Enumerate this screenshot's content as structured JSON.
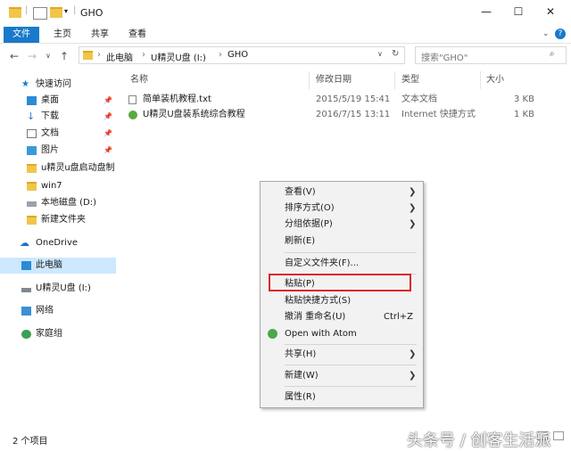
{
  "window": {
    "title": "GHO",
    "minimize": "—",
    "maximize": "☐",
    "close": "✕"
  },
  "ribbon": {
    "tabs": [
      "文件",
      "主页",
      "共享",
      "查看"
    ]
  },
  "addressbar": {
    "segments": [
      "此电脑",
      "U精灵U盘 (I:)",
      "GHO"
    ],
    "search_placeholder": "搜索\"GHO\""
  },
  "sidebar": {
    "items": [
      {
        "label": "快速访问"
      },
      {
        "label": "桌面"
      },
      {
        "label": "下载"
      },
      {
        "label": "文档"
      },
      {
        "label": "图片"
      },
      {
        "label": "u精灵u盘启动盘制"
      },
      {
        "label": "win7"
      },
      {
        "label": "本地磁盘 (D:)"
      },
      {
        "label": "新建文件夹"
      },
      {
        "label": "OneDrive"
      },
      {
        "label": "此电脑"
      },
      {
        "label": "U精灵U盘 (I:)"
      },
      {
        "label": "网络"
      },
      {
        "label": "家庭组"
      }
    ]
  },
  "columns": {
    "name": "名称",
    "modified": "修改日期",
    "type": "类型",
    "size": "大小"
  },
  "files": [
    {
      "name": "简单装机教程.txt",
      "modified": "2015/5/19 15:41",
      "type": "文本文档",
      "size": "3 KB"
    },
    {
      "name": "U精灵U盘装系统综合教程",
      "modified": "2016/7/15 13:11",
      "type": "Internet 快捷方式",
      "size": "1 KB"
    }
  ],
  "status": {
    "count": "2 个项目"
  },
  "context_menu": {
    "items": [
      {
        "label": "查看(V)",
        "shortcut": ""
      },
      {
        "label": "排序方式(O)",
        "shortcut": ""
      },
      {
        "label": "分组依据(P)",
        "shortcut": ""
      },
      {
        "label": "刷新(E)",
        "shortcut": ""
      },
      {
        "label": "自定义文件夹(F)...",
        "shortcut": ""
      },
      {
        "label": "粘贴(P)",
        "shortcut": ""
      },
      {
        "label": "粘贴快捷方式(S)",
        "shortcut": ""
      },
      {
        "label": "撤消 重命名(U)",
        "shortcut": "Ctrl+Z"
      },
      {
        "label": "Open with Atom",
        "shortcut": ""
      },
      {
        "label": "共享(H)",
        "shortcut": ""
      },
      {
        "label": "新建(W)",
        "shortcut": ""
      },
      {
        "label": "属性(R)",
        "shortcut": ""
      }
    ]
  },
  "watermark": "头条号 / 创客生活派",
  "colors": {
    "accent": "#1979ca",
    "selected": "#cde8ff",
    "highlight": "#d9262c"
  }
}
